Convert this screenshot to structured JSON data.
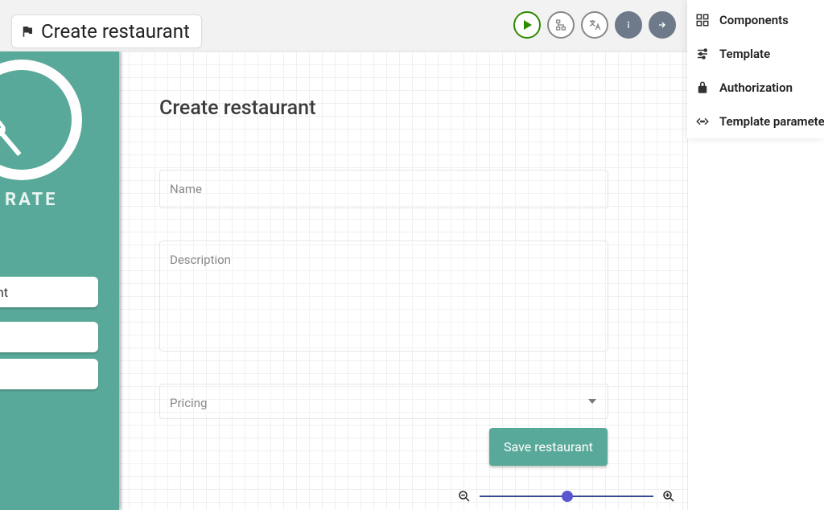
{
  "pageChip": {
    "title": "Create restaurant"
  },
  "sideMenu": {
    "items": [
      {
        "label": "Components"
      },
      {
        "label": "Template"
      },
      {
        "label": "Authorization"
      },
      {
        "label": "Template parameters"
      }
    ]
  },
  "sidebar": {
    "rateLabel": "RATE",
    "button1": "nt"
  },
  "form": {
    "title": "Create restaurant",
    "namePlaceholder": "Name",
    "descriptionPlaceholder": "Description",
    "pricingLabel": "Pricing",
    "saveLabel": "Save restaurant"
  }
}
